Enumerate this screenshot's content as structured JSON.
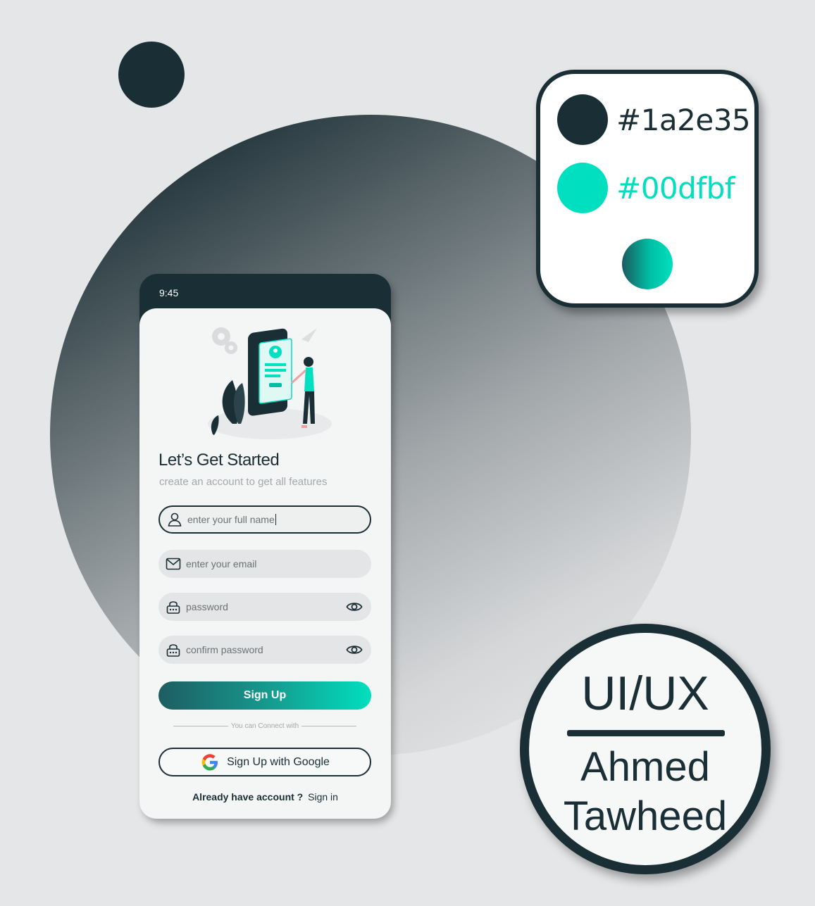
{
  "palette": {
    "colors": [
      {
        "hex": "#1a2e35",
        "label": "#1a2e35"
      },
      {
        "hex": "#00dfbf",
        "label": "#00dfbf"
      }
    ],
    "gradient": [
      "#1a2e35",
      "#00dfbf"
    ]
  },
  "badge": {
    "title": "UI/UX",
    "name_line1": "Ahmed",
    "name_line2": "Tawheed"
  },
  "phone": {
    "status_time": "9:45",
    "title": "Let’s Get Started",
    "subtitle": "create an account to get all features",
    "fields": {
      "full_name": {
        "value": "enter your full name",
        "icon": "user-icon"
      },
      "email": {
        "placeholder": "enter your email",
        "icon": "mail-icon"
      },
      "password": {
        "placeholder": "password",
        "icon": "lock-icon"
      },
      "confirm_password": {
        "placeholder": "confirm password",
        "icon": "lock-icon"
      }
    },
    "signup_label": "Sign Up",
    "connect_text": "You can Connect with",
    "google_label": "Sign Up with Google",
    "already_text": "Already have account ?",
    "signin_link": "Sign in"
  }
}
